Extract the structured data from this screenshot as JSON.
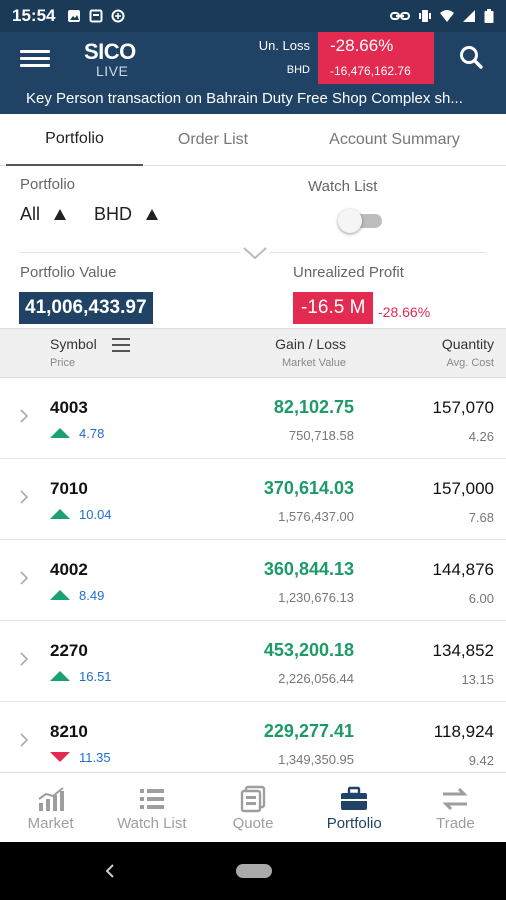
{
  "status_bar": {
    "time": "15:54"
  },
  "header": {
    "logo_top": "SICO",
    "logo_bottom": "LIVE",
    "unrealized_label": "Un. Loss",
    "currency_label": "BHD",
    "loss_pct": "-28.66%",
    "loss_amount": "-16,476,162.76",
    "ticker": "Key Person transaction on Bahrain Duty Free Shop Complex sh..."
  },
  "tabs": [
    {
      "label": "Portfolio",
      "active": true
    },
    {
      "label": "Order List",
      "active": false
    },
    {
      "label": "Account Summary",
      "active": false
    }
  ],
  "filters": {
    "portfolio_label": "Portfolio",
    "portfolio_value": "All",
    "currency_value": "BHD",
    "watchlist_label": "Watch List",
    "watchlist_on": false
  },
  "summary": {
    "portfolio_value_label": "Portfolio Value",
    "portfolio_value": "41,006,433.97",
    "unrealized_label": "Unrealized Profit",
    "unrealized_value": "-16.5 M",
    "unrealized_pct": "-28.66%"
  },
  "table": {
    "headers": {
      "symbol": "Symbol",
      "price": "Price",
      "gain_loss": "Gain / Loss",
      "market_value": "Market Value",
      "quantity": "Quantity",
      "avg_cost": "Avg. Cost"
    },
    "rows": [
      {
        "symbol": "4003",
        "direction": "up",
        "price": "4.78",
        "gain_loss": "82,102.75",
        "market_value": "750,718.58",
        "quantity": "157,070",
        "avg_cost": "4.26"
      },
      {
        "symbol": "7010",
        "direction": "up",
        "price": "10.04",
        "gain_loss": "370,614.03",
        "market_value": "1,576,437.00",
        "quantity": "157,000",
        "avg_cost": "7.68"
      },
      {
        "symbol": "4002",
        "direction": "up",
        "price": "8.49",
        "gain_loss": "360,844.13",
        "market_value": "1,230,676.13",
        "quantity": "144,876",
        "avg_cost": "6.00"
      },
      {
        "symbol": "2270",
        "direction": "up",
        "price": "16.51",
        "gain_loss": "453,200.18",
        "market_value": "2,226,056.44",
        "quantity": "134,852",
        "avg_cost": "13.15"
      },
      {
        "symbol": "8210",
        "direction": "down",
        "price": "11.35",
        "gain_loss": "229,277.41",
        "market_value": "1,349,350.95",
        "quantity": "118,924",
        "avg_cost": "9.42"
      }
    ]
  },
  "bottom_nav": [
    {
      "label": "Market",
      "icon": "market-chart-icon",
      "active": false
    },
    {
      "label": "Watch List",
      "icon": "list-icon",
      "active": false
    },
    {
      "label": "Quote",
      "icon": "quote-icon",
      "active": false
    },
    {
      "label": "Portfolio",
      "icon": "briefcase-icon",
      "active": true
    },
    {
      "label": "Trade",
      "icon": "swap-arrows-icon",
      "active": false
    }
  ],
  "colors": {
    "header_bg": "#1f4265",
    "loss_red": "#e32b52",
    "gain_green": "#1d9a68",
    "price_blue": "#1d6fd0"
  }
}
